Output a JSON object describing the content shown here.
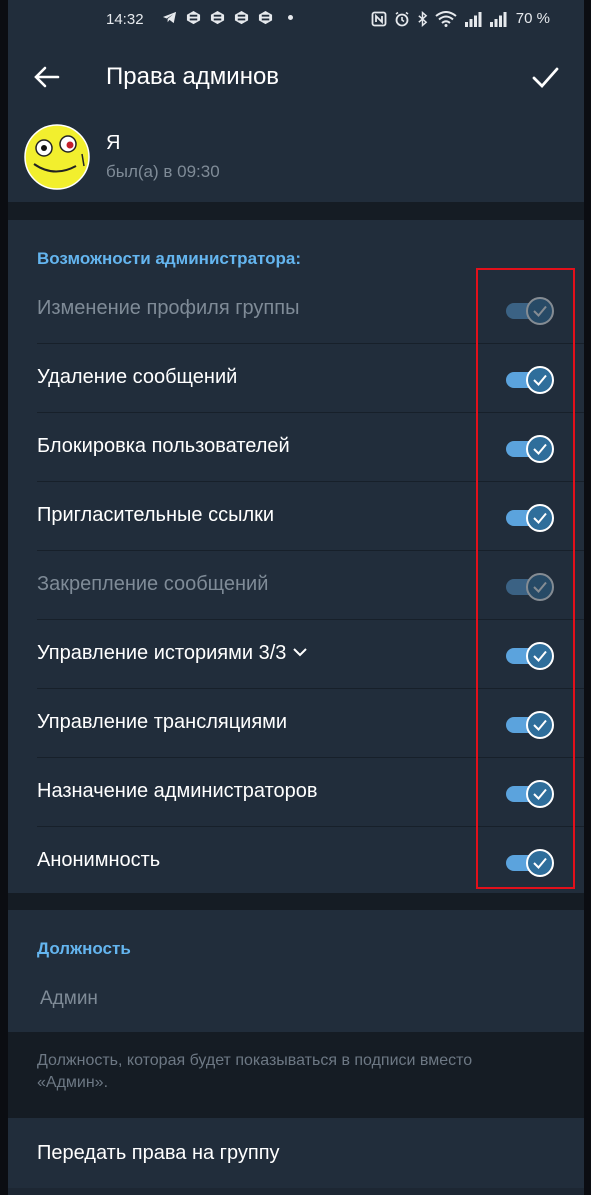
{
  "status_bar": {
    "time": "14:32",
    "battery": "70 %",
    "icons": [
      "telegram-icon",
      "app-icon",
      "app-icon",
      "app-icon",
      "app-icon",
      "nfc-icon",
      "alarm-icon",
      "bluetooth-icon",
      "wifi-icon",
      "signal-icon",
      "signal-icon"
    ]
  },
  "app_bar": {
    "title": "Права админов",
    "back_icon": "arrow-left-icon",
    "done_icon": "checkmark-icon"
  },
  "user": {
    "name": "Я",
    "status": "был(а) в 09:30"
  },
  "rights": {
    "header": "Возможности администратора:",
    "items": [
      {
        "label": "Изменение профиля группы",
        "enabled": true,
        "disabled": true
      },
      {
        "label": "Удаление сообщений",
        "enabled": true,
        "disabled": false
      },
      {
        "label": "Блокировка пользователей",
        "enabled": true,
        "disabled": false
      },
      {
        "label": "Пригласительные ссылки",
        "enabled": true,
        "disabled": false
      },
      {
        "label": "Закрепление сообщений",
        "enabled": true,
        "disabled": true
      },
      {
        "label": "Управление историями 3/3",
        "enabled": true,
        "disabled": false
      },
      {
        "label": "Управление трансляциями",
        "enabled": true,
        "disabled": false
      },
      {
        "label": "Назначение администраторов",
        "enabled": true,
        "disabled": false
      },
      {
        "label": "Анонимность",
        "enabled": true,
        "disabled": false
      }
    ]
  },
  "custom_title": {
    "header": "Должность",
    "placeholder": "Админ",
    "hint": "Должность, которая будет показываться в подписи вместо «Админ»."
  },
  "transfer": {
    "label": "Передать права на группу"
  },
  "colors": {
    "accent": "#64b5ef",
    "toggle_track": "#5ba3dd",
    "highlight_frame": "#e2101b",
    "background": "#212d3b"
  }
}
